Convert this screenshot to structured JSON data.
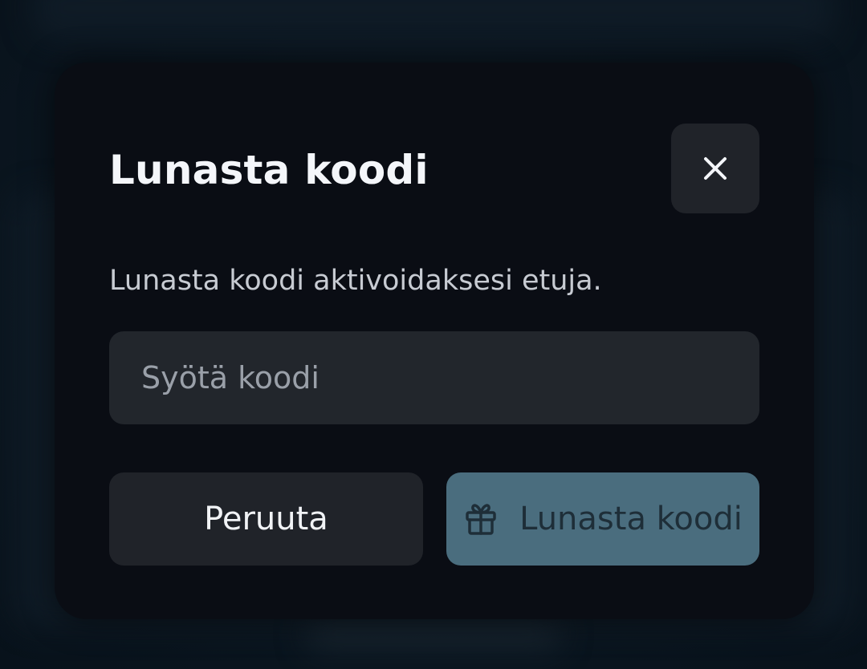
{
  "modal": {
    "title": "Lunasta koodi",
    "description": "Lunasta koodi aktivoidaksesi etuja.",
    "close_icon": "close-icon",
    "code_input": {
      "value": "",
      "placeholder": "Syötä koodi"
    },
    "cancel_label": "Peruuta",
    "redeem_label": "Lunasta koodi",
    "redeem_icon": "gift-icon"
  },
  "colors": {
    "modal_background": "#0a0d14",
    "secondary_button": "#202329",
    "input_background": "#22262c",
    "primary_button_disabled": "#4a6d7e",
    "title_text": "#f4f6fa"
  }
}
